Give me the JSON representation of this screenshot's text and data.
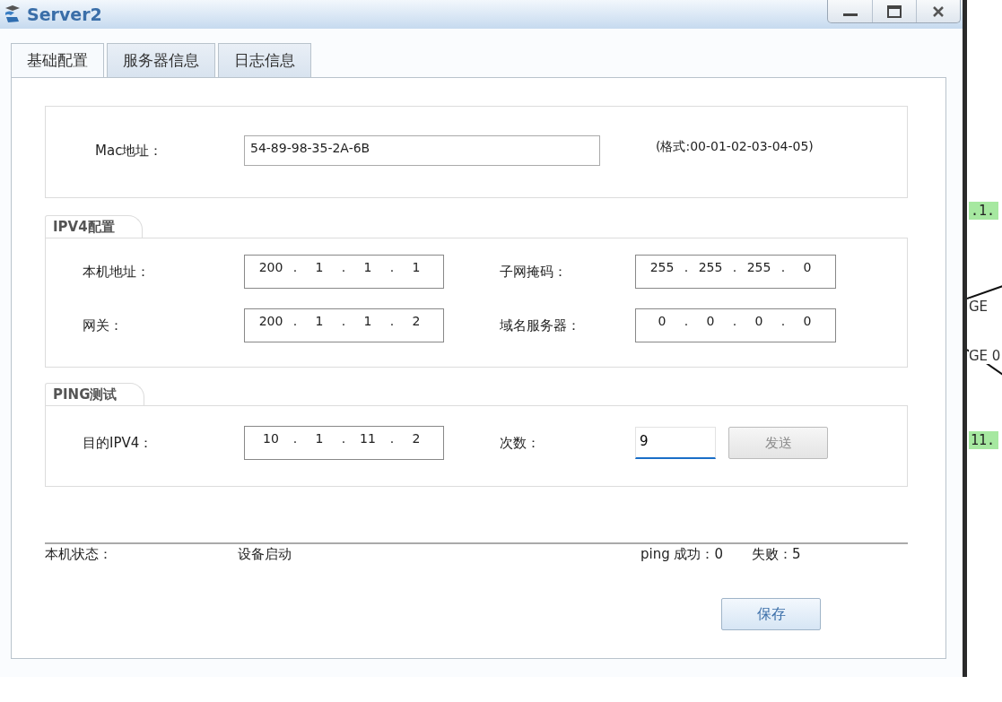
{
  "window": {
    "title": "Server2"
  },
  "tabs": [
    {
      "label": "基础配置",
      "selected": true
    },
    {
      "label": "服务器信息",
      "selected": false
    },
    {
      "label": "日志信息",
      "selected": false
    }
  ],
  "mac": {
    "label": "Mac地址：",
    "value": "54-89-98-35-2A-6B",
    "hint": "(格式:00-01-02-03-04-05)"
  },
  "ipv4": {
    "title": "IPV4配置",
    "fields": [
      {
        "label": "本机地址：",
        "octets": [
          "200",
          ".",
          "1",
          ".",
          "1",
          ".",
          "1"
        ]
      },
      {
        "label": "子网掩码：",
        "octets": [
          "255",
          ".",
          "255",
          ".",
          "255",
          ".",
          "0"
        ]
      },
      {
        "label": "网关：",
        "octets": [
          "200",
          ".",
          "1",
          ".",
          "1",
          ".",
          "2"
        ]
      },
      {
        "label": "域名服务器：",
        "octets": [
          "0",
          ".",
          "0",
          ".",
          "0",
          ".",
          "0"
        ]
      }
    ]
  },
  "ping": {
    "title": "PING测试",
    "target": {
      "label": "目的IPV4：",
      "octets": [
        "10",
        ".",
        "1",
        ".",
        "11",
        ".",
        "2"
      ]
    },
    "count": {
      "label": "次数：",
      "value": "9",
      "focused": true
    },
    "send_button": {
      "label": "发送",
      "disabled": true
    }
  },
  "status": {
    "label": "本机状态：",
    "value": "设备启动",
    "success": "ping 成功：0",
    "fail": "失败：5"
  },
  "save_button": {
    "label": "保存"
  },
  "canvas": {
    "labels": [
      {
        "text": ".1.",
        "kind": "address"
      },
      {
        "text": "GE",
        "kind": "port"
      },
      {
        "text": "GE 0",
        "kind": "port"
      },
      {
        "text": "11.",
        "kind": "address"
      }
    ]
  }
}
